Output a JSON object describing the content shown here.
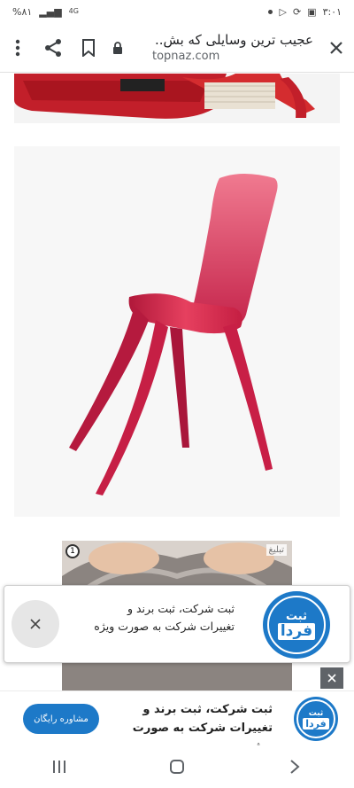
{
  "status_bar": {
    "time": "۳:۰۱",
    "battery": "%۸۱",
    "network": "4G"
  },
  "browser": {
    "page_title": "عجیب ترین وسایلی که بش..",
    "domain": "topnaz.com",
    "icons": [
      "close-icon",
      "lock-icon",
      "bookmark-icon",
      "share-icon",
      "more-vert-icon"
    ]
  },
  "ad": {
    "label": "تبلیغ",
    "badge": "1",
    "popup_text_line1": "ثبت شرکت، ثبت برند و",
    "popup_text_line2": "تغییرات شرکت به صورت ویژه",
    "logo_line1": "ثبت",
    "logo_line2": "فردا",
    "banner_button": "مشاوره رایگان",
    "banner_text_line1": "ثبت شرکت، ثبت برند و",
    "banner_text_line2": "تغییرات شرکت به صورت ویژه"
  },
  "colors": {
    "accent": "#1d79c8",
    "chair": "#d8274f"
  }
}
